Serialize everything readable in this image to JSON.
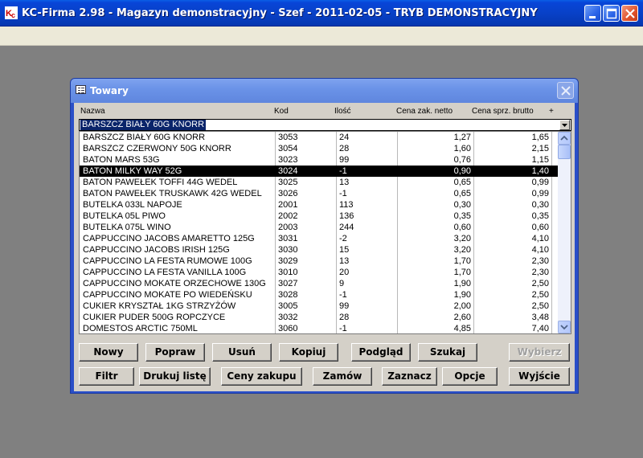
{
  "window": {
    "title": "KC-Firma 2.98 - Magazyn demonstracyjny - Szef - 2011-02-05 - TRYB DEMONSTRACYJNY",
    "icons": [
      "app-icon",
      "minimize-icon",
      "maximize-icon",
      "close-icon"
    ]
  },
  "dialog": {
    "title": "Towary",
    "columns": {
      "nazwa": "Nazwa",
      "kod": "Kod",
      "ilosc": "Ilość",
      "cena_zak": "Cena zak. netto",
      "cena_spr": "Cena sprz. brutto",
      "plus": "+"
    },
    "search_value": "BARSZCZ BIAŁY 60G KNORR",
    "selected_index": 4,
    "rows": [
      {
        "nazwa": "BARSZCZ BIAŁY 60G KNORR",
        "kod": "3053",
        "ilosc": "24",
        "zak": "1,27",
        "spr": "1,65"
      },
      {
        "nazwa": "BARSZCZ CZERWONY 50G KNORR",
        "kod": "3054",
        "ilosc": "28",
        "zak": "1,60",
        "spr": "2,15"
      },
      {
        "nazwa": "BATON MARS 53G",
        "kod": "3023",
        "ilosc": "99",
        "zak": "0,76",
        "spr": "1,15"
      },
      {
        "nazwa": "BATON MILKY WAY 52G",
        "kod": "3024",
        "ilosc": "-1",
        "zak": "0,90",
        "spr": "1,40"
      },
      {
        "nazwa": "BATON PAWEŁEK TOFFI 44G WEDEL",
        "kod": "3025",
        "ilosc": "13",
        "zak": "0,65",
        "spr": "0,99"
      },
      {
        "nazwa": "BATON PAWEŁEK TRUSKAWK 42G WEDEL",
        "kod": "3026",
        "ilosc": "-1",
        "zak": "0,65",
        "spr": "0,99"
      },
      {
        "nazwa": "BUTELKA 033L NAPOJE",
        "kod": "2001",
        "ilosc": "113",
        "zak": "0,30",
        "spr": "0,30"
      },
      {
        "nazwa": "BUTELKA 05L PIWO",
        "kod": "2002",
        "ilosc": "136",
        "zak": "0,35",
        "spr": "0,35"
      },
      {
        "nazwa": "BUTELKA 075L WINO",
        "kod": "2003",
        "ilosc": "244",
        "zak": "0,60",
        "spr": "0,60"
      },
      {
        "nazwa": "CAPPUCCINO JACOBS AMARETTO 125G",
        "kod": "3031",
        "ilosc": "-2",
        "zak": "3,20",
        "spr": "4,10"
      },
      {
        "nazwa": "CAPPUCCINO JACOBS IRISH 125G",
        "kod": "3030",
        "ilosc": "15",
        "zak": "3,20",
        "spr": "4,10"
      },
      {
        "nazwa": "CAPPUCCINO LA FESTA RUMOWE 100G",
        "kod": "3029",
        "ilosc": "13",
        "zak": "1,70",
        "spr": "2,30"
      },
      {
        "nazwa": "CAPPUCCINO LA FESTA VANILLA 100G",
        "kod": "3010",
        "ilosc": "20",
        "zak": "1,70",
        "spr": "2,30"
      },
      {
        "nazwa": "CAPPUCCINO MOKATE ORZECHOWE 130G",
        "kod": "3027",
        "ilosc": "9",
        "zak": "1,90",
        "spr": "2,50"
      },
      {
        "nazwa": "CAPPUCCINO MOKATE PO WIEDEŃSKU",
        "kod": "3028",
        "ilosc": "-1",
        "zak": "1,90",
        "spr": "2,50"
      },
      {
        "nazwa": "CUKIER KRYSZTAŁ 1KG STRZYŻÓW",
        "kod": "3005",
        "ilosc": "99",
        "zak": "2,00",
        "spr": "2,50"
      },
      {
        "nazwa": "CUKIER PUDER 500G ROPCZYCE",
        "kod": "3032",
        "ilosc": "28",
        "zak": "2,60",
        "spr": "3,48"
      },
      {
        "nazwa": "DOMESTOS ARCTIC 750ML",
        "kod": "3060",
        "ilosc": "-1",
        "zak": "4,85",
        "spr": "7,40"
      }
    ],
    "buttons": {
      "nowy": "Nowy",
      "popraw": "Popraw",
      "usun": "Usuń",
      "kopiuj": "Kopiuj",
      "podglad": "Podgląd",
      "szukaj": "Szukaj",
      "wybierz": "Wybierz",
      "filtr": "Filtr",
      "drukuj": "Drukuj listę",
      "ceny": "Ceny zakupu",
      "zamow": "Zamów",
      "zaznacz": "Zaznacz",
      "opcje": "Opcje",
      "wyjscie": "Wyjście"
    }
  },
  "colors": {
    "title_bar": "#0841c8",
    "dialog_title": "#6b93e8",
    "selection": "#000000",
    "face": "#d4d0c8",
    "desktop": "#808080"
  }
}
